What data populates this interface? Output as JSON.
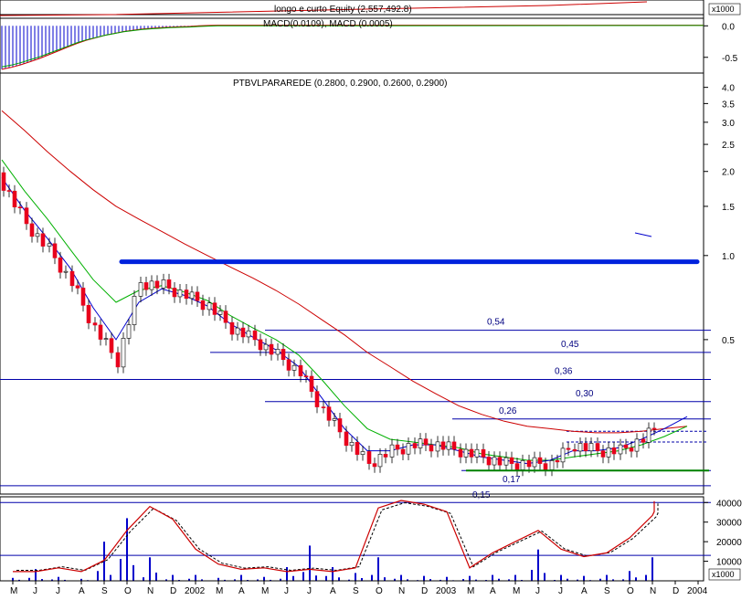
{
  "colors": {
    "background": "#ffffff",
    "frame": "#000000",
    "price_up": "#ffffff",
    "price_down": "#e8001c",
    "ma_short": "#0000cc",
    "ma_medium": "#00b000",
    "ma_long": "#cc0000",
    "horizontal_lines": "#0000aa",
    "resistance": "#0022dd",
    "support": "#008000",
    "equity": "#cc0000",
    "macd_bars": "#0000cc",
    "stoch_main": "#cc0000",
    "stoch_signal": "#000000",
    "volume_bars": "#0000cc",
    "fib_labels": "#000080"
  },
  "chart_data": [
    {
      "panel": "equity-macd",
      "type": "line",
      "title": "longo e curto Equity (2,557,492.8)",
      "subtitle": "MACD(0.0109), MACD (0.0005)",
      "y_tick_labels": [
        "0.0",
        "-0.5"
      ],
      "y_ticks": [
        0.0,
        -0.5
      ],
      "y_unit_label": "x1000",
      "ylim": [
        -0.75,
        0.12
      ],
      "macd": [
        -0.69,
        -0.66,
        -0.62,
        -0.57,
        -0.52,
        -0.46,
        -0.4,
        -0.34,
        -0.28,
        -0.23,
        -0.19,
        -0.15,
        -0.12,
        -0.09,
        -0.07,
        -0.05,
        -0.04,
        -0.03,
        -0.02,
        -0.015,
        -0.01,
        0.0,
        0.005,
        0.01
      ],
      "equity_label_value": "2,557,492.8"
    },
    {
      "panel": "price",
      "type": "candlestick",
      "title": "PTBVLPARAREDE (0.2800, 0.2900, 0.2600, 0.2900)",
      "scale": "log",
      "y_tick_labels": [
        "4.0",
        "3.5",
        "3.0",
        "2.5",
        "2.0",
        "1.5",
        "1.0",
        "0.5"
      ],
      "y_ticks": [
        4.0,
        3.5,
        3.0,
        2.5,
        2.0,
        1.5,
        1.0,
        0.5
      ],
      "ylim": [
        0.14,
        4.5
      ],
      "x_month_labels": [
        "M",
        "J",
        "J",
        "A",
        "S",
        "O",
        "N",
        "D",
        "2002",
        "M",
        "A",
        "M",
        "J",
        "J",
        "A",
        "S",
        "O",
        "N",
        "D",
        "2003",
        "M",
        "A",
        "M",
        "J",
        "J",
        "A",
        "S",
        "O",
        "N",
        "D",
        "2004"
      ],
      "horizontal_levels": [
        {
          "value": 0.54,
          "label": "0,54"
        },
        {
          "value": 0.45,
          "label": "0,45"
        },
        {
          "value": 0.36,
          "label": "0,36"
        },
        {
          "value": 0.3,
          "label": "0,30"
        },
        {
          "value": 0.26,
          "label": "0,26"
        },
        {
          "value": 0.17,
          "label": "0,17"
        },
        {
          "value": 0.15,
          "label": "0,15"
        }
      ],
      "resistance_line": 0.95,
      "support_line": 0.17,
      "close_by_month": [
        1.8,
        1.3,
        1.05,
        0.8,
        0.55,
        0.42,
        0.8,
        0.78,
        0.72,
        0.66,
        0.55,
        0.5,
        0.44,
        0.38,
        0.28,
        0.22,
        0.18,
        0.2,
        0.21,
        0.21,
        0.2,
        0.19,
        0.18,
        0.18,
        0.18,
        0.21,
        0.2,
        0.2,
        0.22,
        0.26,
        0.29
      ],
      "ma_short_by_month": [
        1.9,
        1.45,
        1.15,
        0.9,
        0.65,
        0.5,
        0.68,
        0.76,
        0.72,
        0.66,
        0.57,
        0.51,
        0.46,
        0.4,
        0.31,
        0.24,
        0.2,
        0.2,
        0.21,
        0.21,
        0.2,
        0.19,
        0.185,
        0.18,
        0.185,
        0.2,
        0.2,
        0.205,
        0.22,
        0.24,
        0.265
      ],
      "ma_medium_by_month": [
        2.2,
        1.7,
        1.35,
        1.05,
        0.82,
        0.68,
        0.75,
        0.78,
        0.74,
        0.69,
        0.61,
        0.55,
        0.5,
        0.44,
        0.36,
        0.29,
        0.24,
        0.22,
        0.215,
        0.21,
        0.205,
        0.195,
        0.19,
        0.185,
        0.185,
        0.19,
        0.195,
        0.2,
        0.21,
        0.225,
        0.245
      ],
      "ma_long_by_month": [
        3.3,
        2.8,
        2.35,
        2.0,
        1.72,
        1.5,
        1.35,
        1.22,
        1.1,
        1.0,
        0.91,
        0.83,
        0.75,
        0.67,
        0.59,
        0.52,
        0.45,
        0.4,
        0.355,
        0.32,
        0.29,
        0.27,
        0.255,
        0.245,
        0.24,
        0.235,
        0.232,
        0.232,
        0.235,
        0.24,
        0.245
      ]
    },
    {
      "panel": "volume-stochastic",
      "type": "bar",
      "y_tick_labels": [
        "40000",
        "30000",
        "20000",
        "10000"
      ],
      "y_ticks": [
        40000,
        30000,
        20000,
        10000
      ],
      "y_unit_label": "x1000",
      "ylim": [
        0,
        42000
      ],
      "horizontal_levels": [
        40000,
        13000
      ],
      "stochastic_by_month": [
        0.05,
        0.05,
        0.1,
        0.05,
        0.2,
        0.6,
        0.92,
        0.75,
        0.35,
        0.15,
        0.08,
        0.1,
        0.05,
        0.08,
        0.05,
        0.1,
        0.9,
        1.0,
        0.95,
        0.85,
        0.1,
        0.3,
        0.45,
        0.6,
        0.35,
        0.25,
        0.3,
        0.5,
        0.8,
        0.85,
        0.99
      ],
      "volume_by_month": [
        1500,
        6000,
        2000,
        1000,
        20000,
        32000,
        12000,
        3000,
        3000,
        1500,
        3000,
        2000,
        7000,
        18000,
        7000,
        4000,
        12000,
        3000,
        2500,
        2000,
        2500,
        3000,
        3000,
        16000,
        3000,
        2500,
        3000,
        5000,
        12000,
        25000,
        40000
      ]
    }
  ],
  "header": {
    "equity_title": "longo e curto Equity (2,557,492.8)",
    "macd_title": "MACD(0.0109), MACD (0.0005)",
    "price_title": "PTBVLPARAREDE (0.2800, 0.2900, 0.2600, 0.2900)",
    "top_unit": "x1000",
    "bottom_unit": "x1000"
  }
}
